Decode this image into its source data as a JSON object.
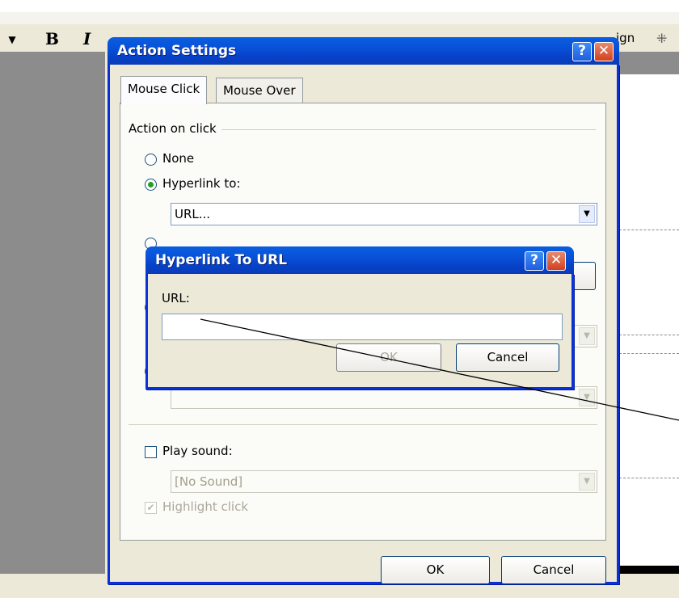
{
  "app": {
    "toolbar": {
      "bold_label": "B",
      "italic_label": "I",
      "design_label": "ign",
      "design_icon": "design-icon"
    }
  },
  "action_dialog": {
    "title": "Action Settings",
    "help_glyph": "?",
    "close_glyph": "✕",
    "tabs": [
      {
        "label": "Mouse Click",
        "active": true
      },
      {
        "label": "Mouse Over",
        "active": false
      }
    ],
    "group_label": "Action on click",
    "option_none": "None",
    "option_hyperlink": "Hyperlink to:",
    "hyperlink_value": "URL...",
    "play_sound_label": "Play sound:",
    "sound_value": "[No Sound]",
    "highlight_label": "Highlight click",
    "ok_label": "OK",
    "cancel_label": "Cancel"
  },
  "url_dialog": {
    "title": "Hyperlink To URL",
    "help_glyph": "?",
    "close_glyph": "✕",
    "url_label": "URL:",
    "url_value": "",
    "ok_label": "OK",
    "cancel_label": "Cancel"
  },
  "colors": {
    "titlebar": "#0851d8",
    "dialog_bg": "#ece9d8",
    "close_button": "#d2401f"
  }
}
